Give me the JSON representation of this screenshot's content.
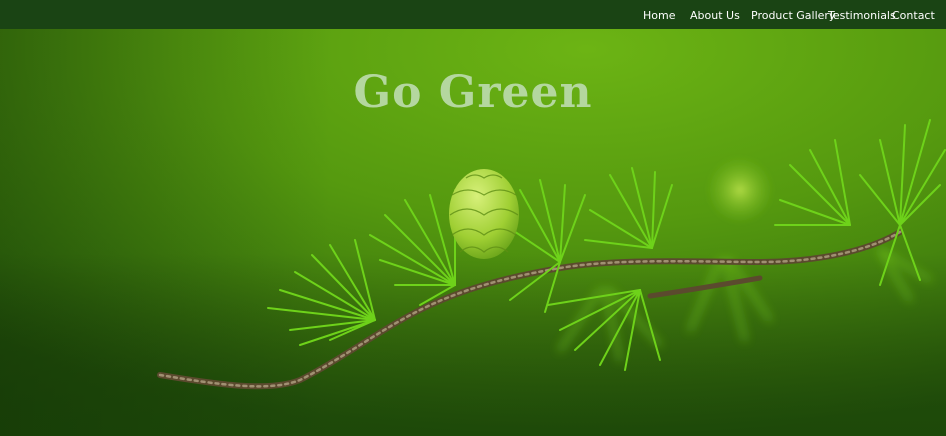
{
  "nav": {
    "items": [
      {
        "label": "Home"
      },
      {
        "label": "About Us"
      },
      {
        "label": "Product Gallery"
      },
      {
        "label": "Testimonials"
      },
      {
        "label": "Contact"
      }
    ]
  },
  "hero": {
    "title": "Go Green",
    "image_icon": "larch-branch-image"
  },
  "colors": {
    "nav_background": "#1a4414",
    "hero_green": "#5aa012",
    "title_color": "#b4d79f"
  }
}
